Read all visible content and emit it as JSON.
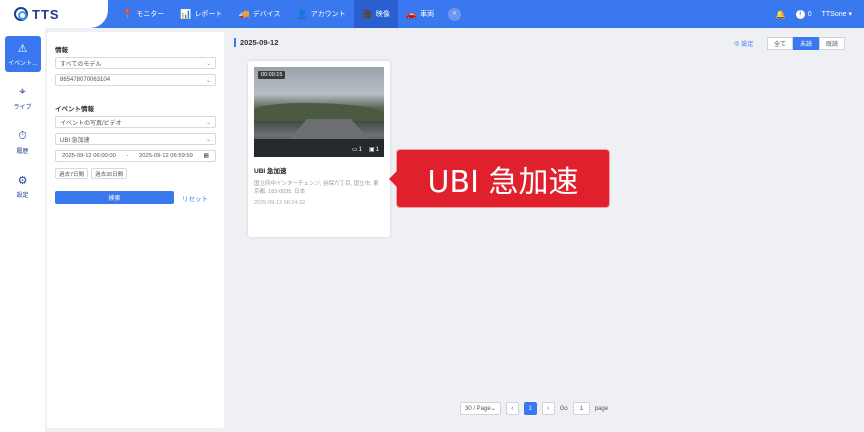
{
  "logo": {
    "text": "TTS"
  },
  "nav": [
    {
      "icon": "📍",
      "label": "モニター"
    },
    {
      "icon": "📊",
      "label": "レポート"
    },
    {
      "icon": "🚚",
      "label": "デバイス"
    },
    {
      "icon": "👤",
      "label": "アカウント"
    },
    {
      "icon": "🎥",
      "label": "映像"
    },
    {
      "icon": "🚗",
      "label": "車両"
    }
  ],
  "topright": {
    "notif_count": "0",
    "user": "TTSone"
  },
  "rail": [
    {
      "icon": "⚠",
      "label": "イベント..."
    },
    {
      "icon": "⌖",
      "label": "ライブ"
    },
    {
      "icon": "⏱",
      "label": "履歴"
    },
    {
      "icon": "⚙",
      "label": "設定"
    }
  ],
  "filter": {
    "info_label": "情報",
    "model_select": "すべてのモデル",
    "device_select": "865478070063104",
    "event_label": "イベント情報",
    "media_select": "イベントの写真/ビデオ",
    "event_type_select": "UBI 急加速",
    "date_from": "2025-09-12 06:00:00",
    "date_sep": "-",
    "date_to": "2025-09-12 06:59:59",
    "quick_7": "過去7日間",
    "quick_30": "過去30日間",
    "search_label": "検索",
    "reset_label": "リセット"
  },
  "main": {
    "date": "2025-09-12",
    "settings_label": "設定",
    "seg": [
      "全て",
      "未読",
      "既読"
    ],
    "card": {
      "duration": "00:00:15",
      "video_count": "1",
      "photo_count": "1",
      "title": "UBI 急加速",
      "address": "国立府中インターチェンジ, 谷保六丁目, 国立市, 東京都, 183-0035, 日本",
      "time": "2025-09-12 06:24:32"
    },
    "callout": "UBI 急加速"
  },
  "pager": {
    "per_page": "30 / Page",
    "current": "1",
    "go_label": "Go",
    "go_value": "1",
    "page_label": "page"
  }
}
